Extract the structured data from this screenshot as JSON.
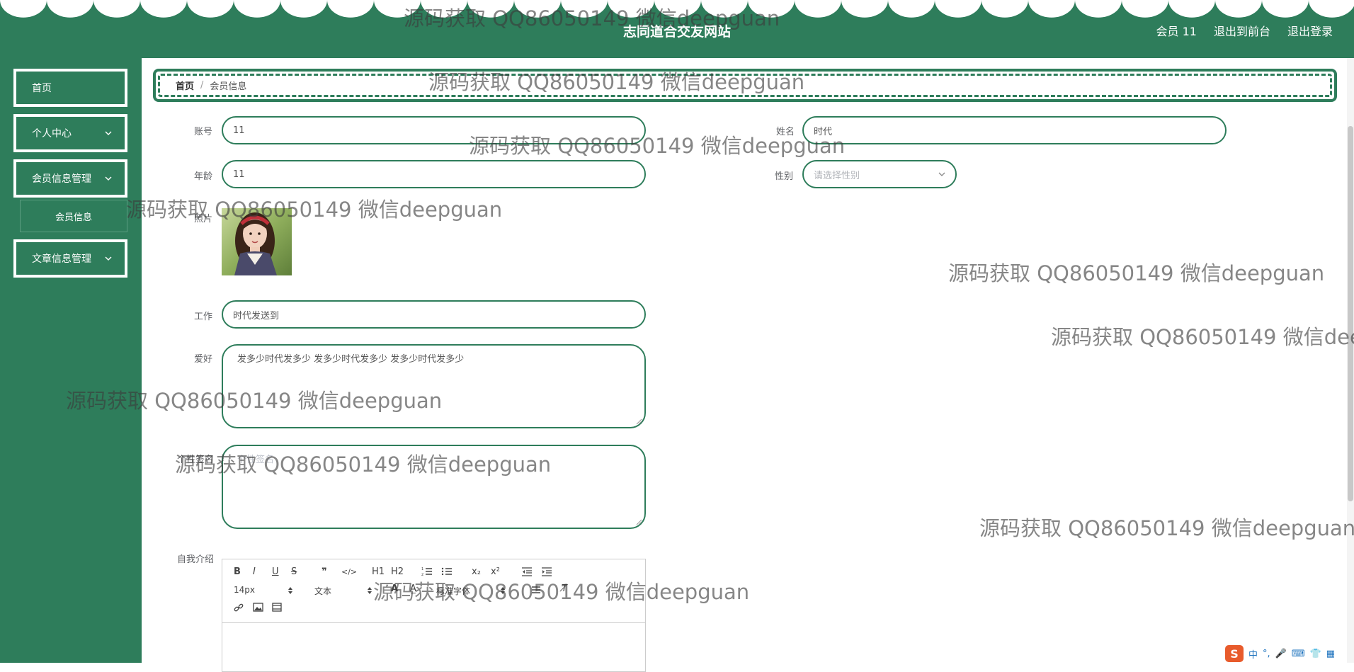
{
  "header": {
    "site_title": "志同道合交友网站",
    "links": [
      "会员 11",
      "退出到前台",
      "退出登录"
    ]
  },
  "sidebar": {
    "items": [
      {
        "label": "首页",
        "has_arrow": false
      },
      {
        "label": "个人中心",
        "has_arrow": true
      },
      {
        "label": "会员信息管理",
        "has_arrow": true
      },
      {
        "label": "文章信息管理",
        "has_arrow": true
      }
    ],
    "sub_item": "会员信息"
  },
  "breadcrumb": {
    "home": "首页",
    "separator": "/",
    "current": "会员信息"
  },
  "form": {
    "account": {
      "label": "账号",
      "value": "11"
    },
    "name": {
      "label": "姓名",
      "value": "时代"
    },
    "age": {
      "label": "年龄",
      "value": "11"
    },
    "gender": {
      "label": "性别",
      "placeholder": "请选择性别"
    },
    "photo": {
      "label": "照片"
    },
    "job": {
      "label": "工作",
      "value": "时代发送到"
    },
    "hobby": {
      "label": "爱好",
      "value": "发多少时代发多少 发多少时代发多少 发多少时代发多少"
    },
    "signature": {
      "label": "个性签名",
      "placeholder": "个性签名"
    },
    "intro": {
      "label": "自我介绍"
    }
  },
  "editor": {
    "buttons": [
      "B",
      "I",
      "U",
      "S",
      "❞",
      "</>",
      "H1",
      "H2",
      "ol",
      "ul",
      "x₂",
      "x²",
      "outdent",
      "indent"
    ],
    "font_size": "14px",
    "heading": "文本",
    "font_family": "标准字体"
  },
  "watermark": "源码获取 QQ86050149 微信deepguan",
  "colors": {
    "primary_green": "#2e7d5b",
    "white": "#ffffff"
  },
  "ime": {
    "lang": "中"
  }
}
